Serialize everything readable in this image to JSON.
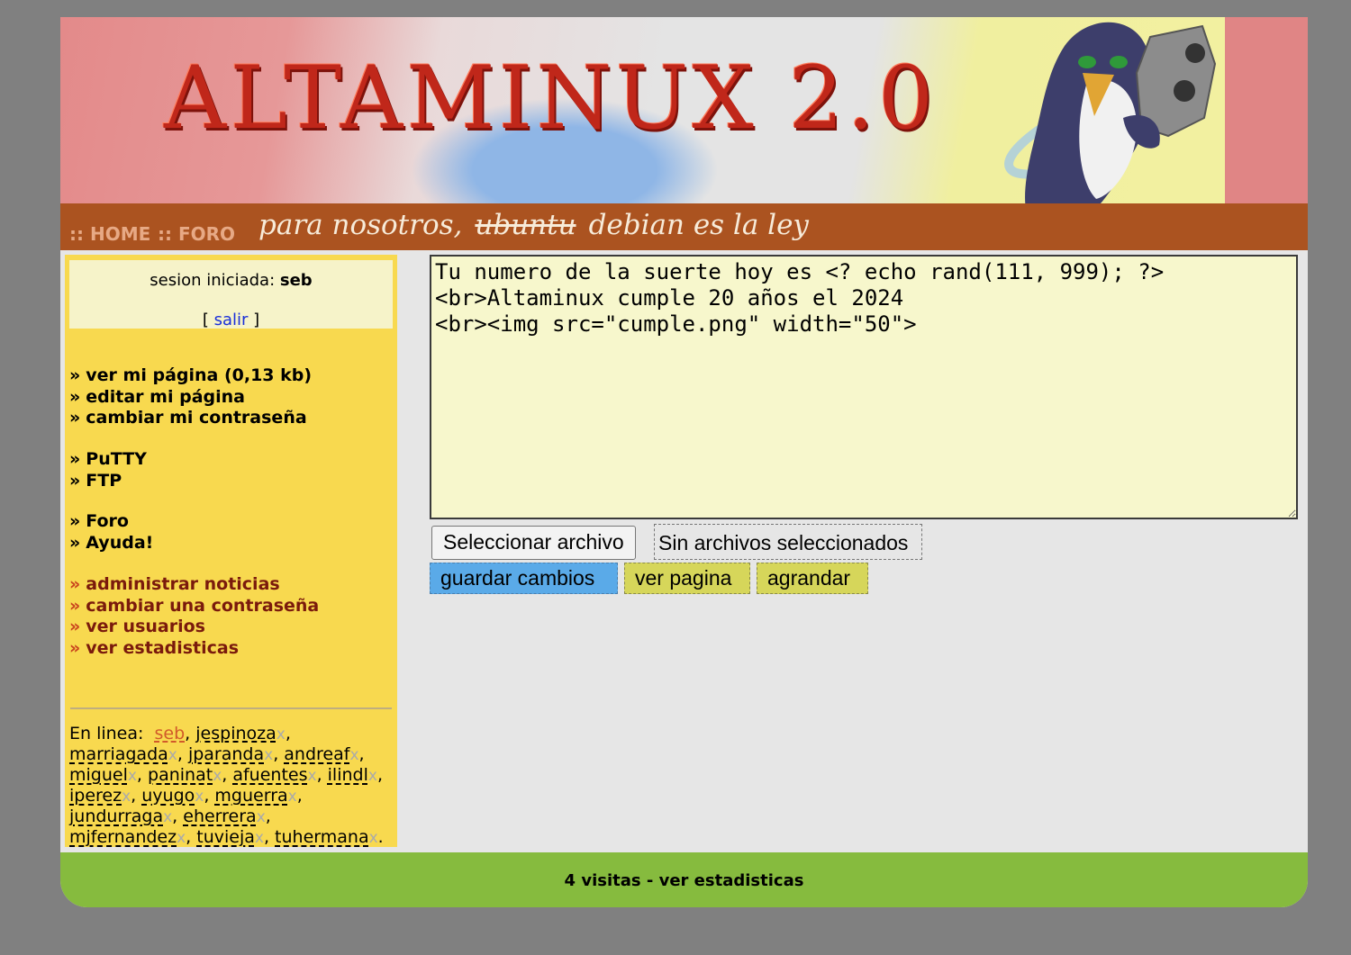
{
  "site": {
    "logo_text": "ALTAMINUX 2.0",
    "nav": {
      "home": ":: HOME",
      "foro": ":: FORO"
    },
    "slogan": {
      "before": "para nosotros,",
      "struck": "ubuntu",
      "after": "debian es la ley"
    }
  },
  "session": {
    "label": "sesion iniciada:",
    "user": "seb",
    "logout_open": "[",
    "logout_label": "salir",
    "logout_close": "]"
  },
  "menu_user": [
    {
      "arrow": "»",
      "label": "ver mi página (0,13 kb)"
    },
    {
      "arrow": "»",
      "label": "editar mi página"
    },
    {
      "arrow": "»",
      "label": "cambiar mi contraseña"
    },
    {
      "arrow": "»",
      "label": "PuTTY"
    },
    {
      "arrow": "»",
      "label": "FTP"
    },
    {
      "arrow": "»",
      "label": "Foro"
    },
    {
      "arrow": "»",
      "label": "Ayuda!"
    }
  ],
  "menu_admin": [
    {
      "arrow": "»",
      "label": "administrar noticias"
    },
    {
      "arrow": "»",
      "label": "cambiar una contraseña"
    },
    {
      "arrow": "»",
      "label": "ver usuarios"
    },
    {
      "arrow": "»",
      "label": "ver estadisticas"
    }
  ],
  "online": {
    "label": "En linea:",
    "users": [
      "seb",
      "jespinoza",
      "marriagada",
      "jparanda",
      "andreaf",
      "miguel",
      "paninat",
      "afuentes",
      "ilindl",
      "iperez",
      "uyugo",
      "mguerra",
      "jundurraga",
      "eherrera",
      "mjfernandez",
      "tuvieja",
      "tuhermana"
    ],
    "kick_symbol": "x"
  },
  "editor": {
    "content": "Tu numero de la suerte hoy es <? echo rand(111, 999); ?>\n<br>Altaminux cumple 20 años el 2024\n<br><img src=\"cumple.png\" width=\"50\">"
  },
  "file_input": {
    "button_label": "Seleccionar archivo",
    "status": "Sin archivos seleccionados"
  },
  "actions": {
    "save": "guardar cambios",
    "view": "ver pagina",
    "enlarge": "agrandar"
  },
  "footer": {
    "text": "4 visitas - ver estadisticas"
  },
  "colors": {
    "page_bg": "#808080",
    "nav_bar": "#ab5320",
    "sidebar": "#f8d94f",
    "footer": "#86bb3e",
    "save_button": "#5aaae8",
    "secondary_button": "#d6d65a",
    "editor_bg": "#f7f7cc"
  }
}
